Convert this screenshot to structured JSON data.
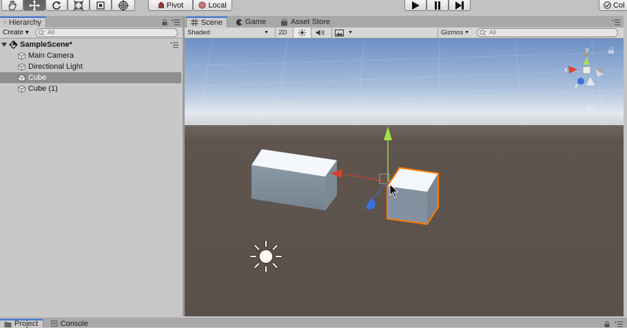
{
  "toolbar": {
    "pivot_label": "Pivot",
    "local_label": "Local",
    "collab_label": "Col"
  },
  "hierarchy": {
    "tab_label": "Hierarchy",
    "create_label": "Create",
    "search_placeholder": "All",
    "scene_name": "SampleScene*",
    "items": [
      {
        "label": "Main Camera"
      },
      {
        "label": "Directional Light"
      },
      {
        "label": "Cube",
        "selected": true
      },
      {
        "label": "Cube (1)"
      }
    ]
  },
  "scene_tabs": {
    "scene": "Scene",
    "game": "Game",
    "asset_store": "Asset Store"
  },
  "scene_toolbar": {
    "shading_mode": "Shaded",
    "mode_2d": "2D",
    "gizmos_label": "Gizmos",
    "search_placeholder": "All"
  },
  "gizmo": {
    "x_label": "x",
    "y_label": "y",
    "z_label": "z",
    "projection": "Iso"
  },
  "bottom_tabs": {
    "project": "Project",
    "console": "Console"
  },
  "colors": {
    "selection_outline": "#ff7a00",
    "sky_top": "#6f93c7",
    "ground": "#5f554e",
    "active_tab_accent": "#3a72d9"
  }
}
